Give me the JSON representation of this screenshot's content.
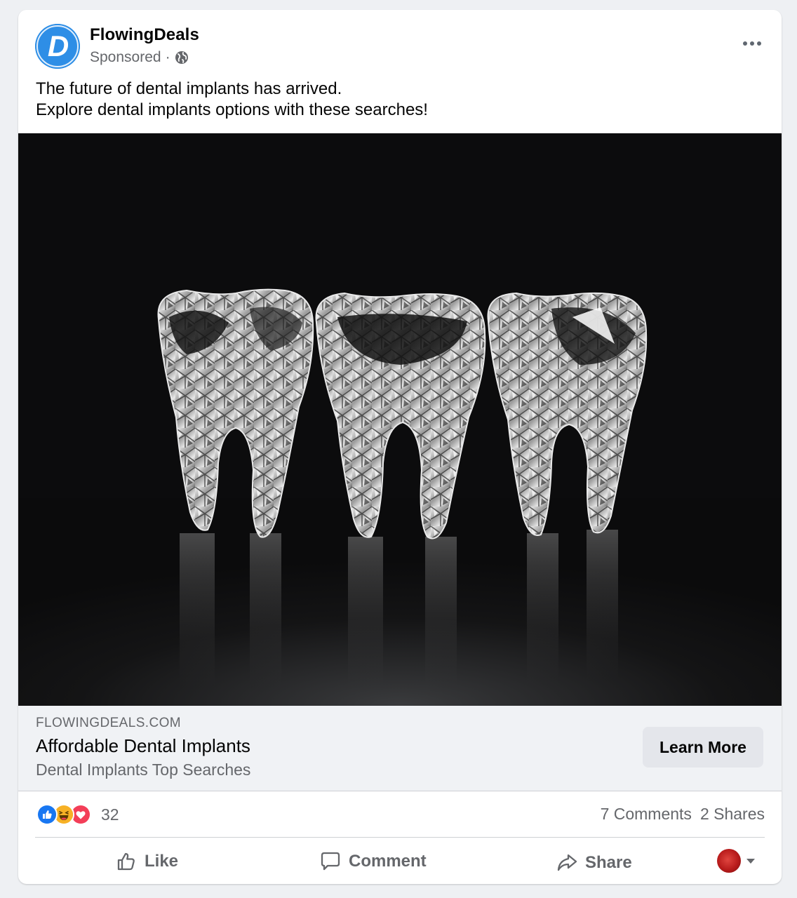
{
  "post": {
    "page_name": "FlowingDeals",
    "sponsored_label": "Sponsored",
    "meta_separator": "·",
    "avatar_letter": "D",
    "text_lines": [
      "The future of dental implants has arrived.",
      "Explore dental implants options with these searches!"
    ]
  },
  "link": {
    "domain": "FLOWINGDEALS.COM",
    "headline": "Affordable Dental Implants",
    "description": "Dental Implants Top Searches",
    "cta_label": "Learn More"
  },
  "stats": {
    "reaction_icons": [
      "like-icon",
      "haha-icon",
      "love-icon"
    ],
    "reaction_count": "32",
    "comments": "7 Comments",
    "shares": "2 Shares"
  },
  "actions": {
    "like": "Like",
    "comment": "Comment",
    "share": "Share"
  },
  "colors": {
    "brand_blue": "#1877f2",
    "avatar_blue": "#2e8ee6",
    "love_red": "#f33e58",
    "haha_yellow": "#f7b125"
  }
}
